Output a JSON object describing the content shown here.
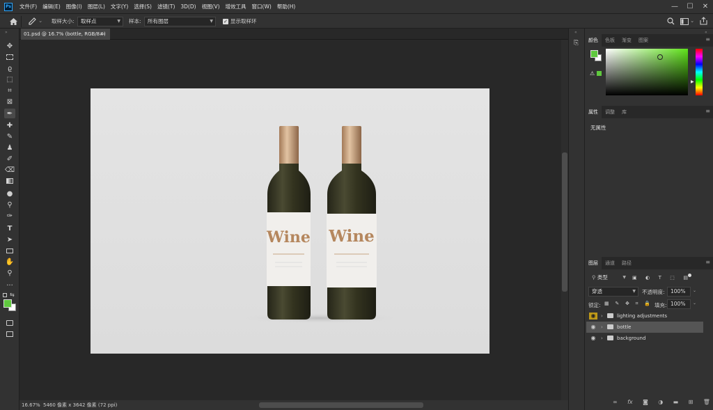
{
  "app": {
    "logo": "Ps"
  },
  "menu": [
    "文件(F)",
    "编辑(E)",
    "图像(I)",
    "图层(L)",
    "文字(Y)",
    "选择(S)",
    "滤镜(T)",
    "3D(D)",
    "视图(V)",
    "增效工具",
    "窗口(W)",
    "帮助(H)"
  ],
  "window_controls": {
    "minimize": "—",
    "maximize": "☐",
    "close": "✕"
  },
  "options": {
    "sample_size_label": "取样大小:",
    "sample_size_value": "取样点",
    "sample_label": "样本:",
    "sample_value": "所有图层",
    "show_ring_label": "显示取样环"
  },
  "document": {
    "tab_title": "01.psd @ 16.7% (bottle, RGB/8#)",
    "close": "×"
  },
  "artwork": {
    "label_text": "Wine",
    "colors": {
      "bottle": "#3a3a26",
      "cap": "#c9a07c",
      "label": "#f3f1ee",
      "label_text": "#b5875e"
    }
  },
  "status": {
    "zoom": "16.67%",
    "info": "5460 像素 x 3642 像素 (72 ppi)"
  },
  "panels": {
    "color_tabs": [
      "颜色",
      "色板",
      "渐变",
      "图案"
    ],
    "fg_color": "#5fc83e",
    "bg_color": "#ffffff",
    "properties_tabs": [
      "属性",
      "调整",
      "库"
    ],
    "properties_empty": "无属性",
    "layers_tabs": [
      "图层",
      "通道",
      "路径"
    ],
    "kind_filter": "类型",
    "blend_mode": "穿透",
    "opacity_label": "不透明度:",
    "opacity_value": "100%",
    "lock_label": "锁定:",
    "fill_label": "填充:",
    "fill_value": "100%",
    "layers": [
      {
        "name": "lighting adjustments"
      },
      {
        "name": "bottle"
      },
      {
        "name": "background"
      }
    ]
  }
}
